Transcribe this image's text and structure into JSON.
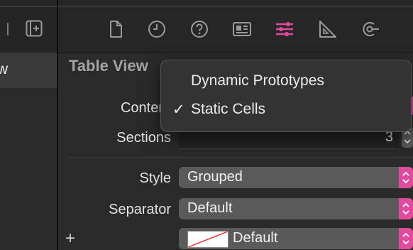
{
  "navigator": {
    "selected_fragment": "w"
  },
  "inspector": {
    "tabs": [
      {
        "name": "file-inspector-tab"
      },
      {
        "name": "history-inspector-tab"
      },
      {
        "name": "quick-help-tab"
      },
      {
        "name": "identity-inspector-tab"
      },
      {
        "name": "attributes-inspector-tab",
        "selected": true
      },
      {
        "name": "size-inspector-tab"
      },
      {
        "name": "connections-inspector-tab"
      }
    ],
    "section_title": "Table View",
    "content_label": "Conter",
    "sections_label": "Sections",
    "sections_value": "3",
    "style_label": "Style",
    "style_value": "Grouped",
    "separator_label": "Separator",
    "separator_value": "Default",
    "separator_color_value": "Default",
    "add_label": "+"
  },
  "menu": {
    "items": [
      {
        "label": "Dynamic Prototypes",
        "checked": false
      },
      {
        "label": "Static Cells",
        "checked": true
      }
    ],
    "check_glyph": "✓"
  },
  "colors": {
    "accent": "#e04b9d",
    "icon": "#9a9a9a",
    "background": "#2a2a2a"
  }
}
